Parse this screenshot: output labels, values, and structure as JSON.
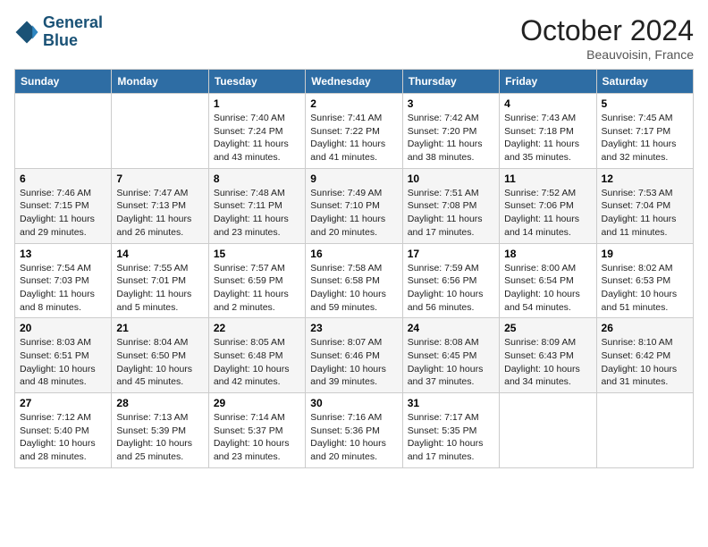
{
  "header": {
    "logo_line1": "General",
    "logo_line2": "Blue",
    "month": "October 2024",
    "location": "Beauvoisin, France"
  },
  "days_of_week": [
    "Sunday",
    "Monday",
    "Tuesday",
    "Wednesday",
    "Thursday",
    "Friday",
    "Saturday"
  ],
  "weeks": [
    [
      {
        "day": "",
        "info": ""
      },
      {
        "day": "",
        "info": ""
      },
      {
        "day": "1",
        "info": "Sunrise: 7:40 AM\nSunset: 7:24 PM\nDaylight: 11 hours and 43 minutes."
      },
      {
        "day": "2",
        "info": "Sunrise: 7:41 AM\nSunset: 7:22 PM\nDaylight: 11 hours and 41 minutes."
      },
      {
        "day": "3",
        "info": "Sunrise: 7:42 AM\nSunset: 7:20 PM\nDaylight: 11 hours and 38 minutes."
      },
      {
        "day": "4",
        "info": "Sunrise: 7:43 AM\nSunset: 7:18 PM\nDaylight: 11 hours and 35 minutes."
      },
      {
        "day": "5",
        "info": "Sunrise: 7:45 AM\nSunset: 7:17 PM\nDaylight: 11 hours and 32 minutes."
      }
    ],
    [
      {
        "day": "6",
        "info": "Sunrise: 7:46 AM\nSunset: 7:15 PM\nDaylight: 11 hours and 29 minutes."
      },
      {
        "day": "7",
        "info": "Sunrise: 7:47 AM\nSunset: 7:13 PM\nDaylight: 11 hours and 26 minutes."
      },
      {
        "day": "8",
        "info": "Sunrise: 7:48 AM\nSunset: 7:11 PM\nDaylight: 11 hours and 23 minutes."
      },
      {
        "day": "9",
        "info": "Sunrise: 7:49 AM\nSunset: 7:10 PM\nDaylight: 11 hours and 20 minutes."
      },
      {
        "day": "10",
        "info": "Sunrise: 7:51 AM\nSunset: 7:08 PM\nDaylight: 11 hours and 17 minutes."
      },
      {
        "day": "11",
        "info": "Sunrise: 7:52 AM\nSunset: 7:06 PM\nDaylight: 11 hours and 14 minutes."
      },
      {
        "day": "12",
        "info": "Sunrise: 7:53 AM\nSunset: 7:04 PM\nDaylight: 11 hours and 11 minutes."
      }
    ],
    [
      {
        "day": "13",
        "info": "Sunrise: 7:54 AM\nSunset: 7:03 PM\nDaylight: 11 hours and 8 minutes."
      },
      {
        "day": "14",
        "info": "Sunrise: 7:55 AM\nSunset: 7:01 PM\nDaylight: 11 hours and 5 minutes."
      },
      {
        "day": "15",
        "info": "Sunrise: 7:57 AM\nSunset: 6:59 PM\nDaylight: 11 hours and 2 minutes."
      },
      {
        "day": "16",
        "info": "Sunrise: 7:58 AM\nSunset: 6:58 PM\nDaylight: 10 hours and 59 minutes."
      },
      {
        "day": "17",
        "info": "Sunrise: 7:59 AM\nSunset: 6:56 PM\nDaylight: 10 hours and 56 minutes."
      },
      {
        "day": "18",
        "info": "Sunrise: 8:00 AM\nSunset: 6:54 PM\nDaylight: 10 hours and 54 minutes."
      },
      {
        "day": "19",
        "info": "Sunrise: 8:02 AM\nSunset: 6:53 PM\nDaylight: 10 hours and 51 minutes."
      }
    ],
    [
      {
        "day": "20",
        "info": "Sunrise: 8:03 AM\nSunset: 6:51 PM\nDaylight: 10 hours and 48 minutes."
      },
      {
        "day": "21",
        "info": "Sunrise: 8:04 AM\nSunset: 6:50 PM\nDaylight: 10 hours and 45 minutes."
      },
      {
        "day": "22",
        "info": "Sunrise: 8:05 AM\nSunset: 6:48 PM\nDaylight: 10 hours and 42 minutes."
      },
      {
        "day": "23",
        "info": "Sunrise: 8:07 AM\nSunset: 6:46 PM\nDaylight: 10 hours and 39 minutes."
      },
      {
        "day": "24",
        "info": "Sunrise: 8:08 AM\nSunset: 6:45 PM\nDaylight: 10 hours and 37 minutes."
      },
      {
        "day": "25",
        "info": "Sunrise: 8:09 AM\nSunset: 6:43 PM\nDaylight: 10 hours and 34 minutes."
      },
      {
        "day": "26",
        "info": "Sunrise: 8:10 AM\nSunset: 6:42 PM\nDaylight: 10 hours and 31 minutes."
      }
    ],
    [
      {
        "day": "27",
        "info": "Sunrise: 7:12 AM\nSunset: 5:40 PM\nDaylight: 10 hours and 28 minutes."
      },
      {
        "day": "28",
        "info": "Sunrise: 7:13 AM\nSunset: 5:39 PM\nDaylight: 10 hours and 25 minutes."
      },
      {
        "day": "29",
        "info": "Sunrise: 7:14 AM\nSunset: 5:37 PM\nDaylight: 10 hours and 23 minutes."
      },
      {
        "day": "30",
        "info": "Sunrise: 7:16 AM\nSunset: 5:36 PM\nDaylight: 10 hours and 20 minutes."
      },
      {
        "day": "31",
        "info": "Sunrise: 7:17 AM\nSunset: 5:35 PM\nDaylight: 10 hours and 17 minutes."
      },
      {
        "day": "",
        "info": ""
      },
      {
        "day": "",
        "info": ""
      }
    ]
  ]
}
